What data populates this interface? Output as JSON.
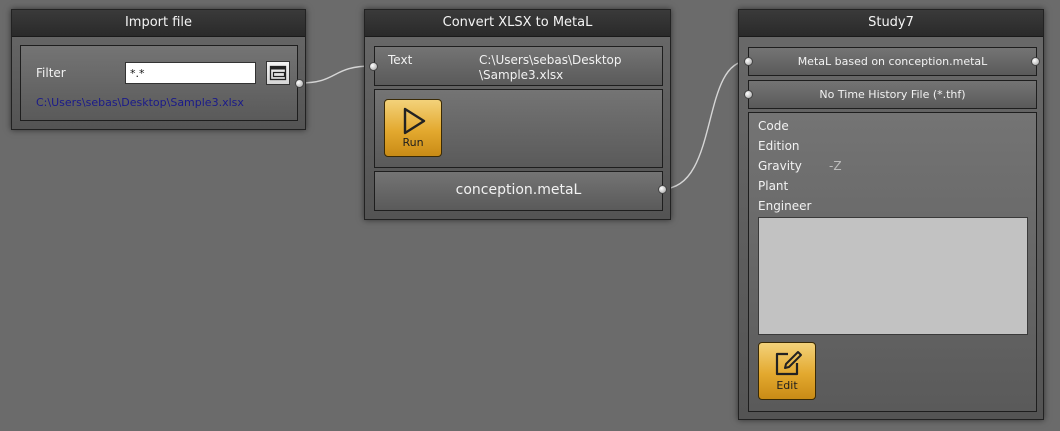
{
  "import_node": {
    "title": "Import file",
    "filter_label": "Filter",
    "filter_value": "*.*",
    "file_path": "C:\\Users\\sebas\\Desktop\\Sample3.xlsx",
    "browse_icon": "folder-open-icon"
  },
  "convert_node": {
    "title": "Convert XLSX to MetaL",
    "text_label": "Text",
    "text_value_line1": "C:\\Users\\sebas\\Desktop",
    "text_value_line2": "\\Sample3.xlsx",
    "run_label": "Run",
    "run_icon": "play-icon",
    "output_label": "conception.metaL"
  },
  "study_node": {
    "title": "Study7",
    "input_metal": "MetaL based on conception.metaL",
    "input_thf": "No Time History File (*.thf)",
    "fields": [
      {
        "label": "Code",
        "value": ""
      },
      {
        "label": "Edition",
        "value": ""
      },
      {
        "label": "Gravity",
        "value": "-Z"
      },
      {
        "label": "Plant",
        "value": ""
      },
      {
        "label": "Engineer",
        "value": ""
      }
    ],
    "edit_label": "Edit",
    "edit_icon": "edit-icon"
  },
  "colors": {
    "canvas": "#6b6b6b",
    "header": "#2e2e2e",
    "button_gold": "#e3a92f",
    "path_link": "#1a1a8a",
    "wire": "#d8d8d8"
  }
}
